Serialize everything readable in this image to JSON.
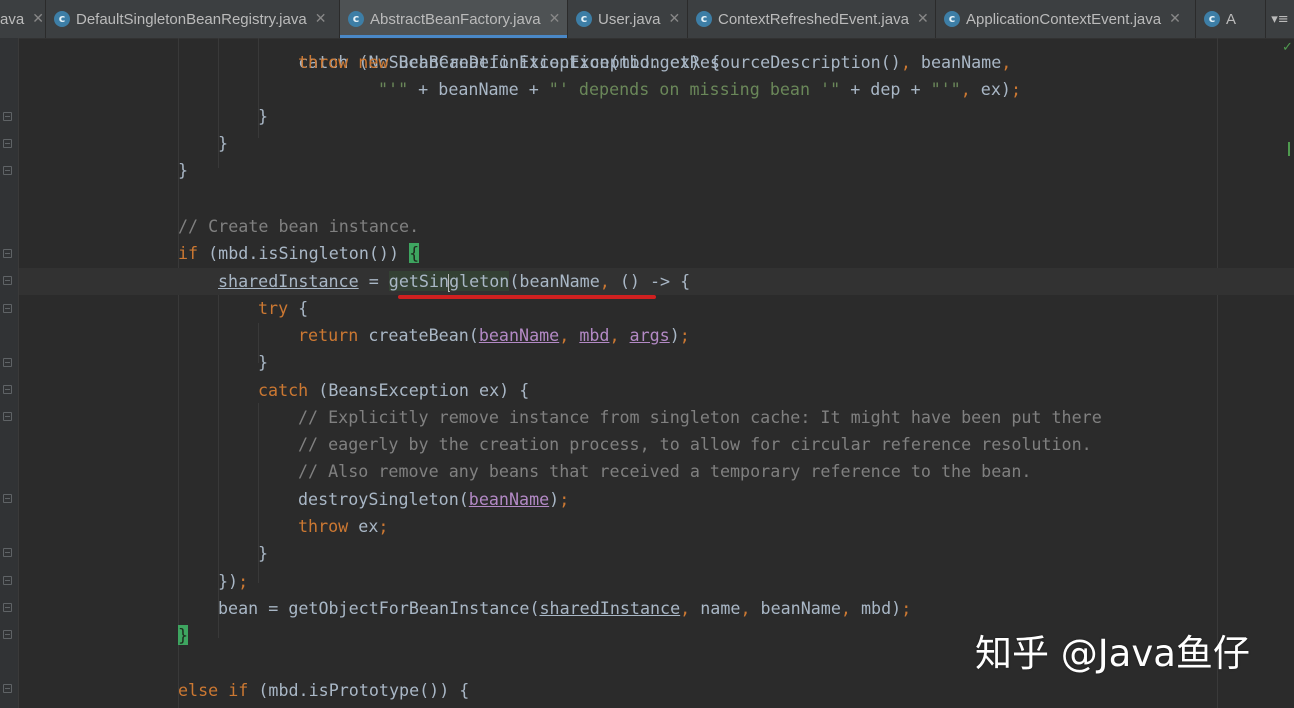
{
  "tabs": [
    {
      "label": "ava",
      "icon": "none",
      "active": false
    },
    {
      "label": "DefaultSingletonBeanRegistry.java",
      "icon": "java-class-icon",
      "active": false
    },
    {
      "label": "AbstractBeanFactory.java",
      "icon": "java-class-icon",
      "active": true
    },
    {
      "label": "User.java",
      "icon": "java-class-icon",
      "active": false
    },
    {
      "label": "ContextRefreshedEvent.java",
      "icon": "java-class-icon",
      "active": false
    },
    {
      "label": "ApplicationContextEvent.java",
      "icon": "java-class-icon",
      "active": false
    },
    {
      "label": "A",
      "icon": "java-class-icon",
      "active": false
    }
  ],
  "tab_menu_label": "▾≡",
  "code": {
    "l0": {
      "p1": "catch (NoSuchBeanDefinitionException ex) {"
    },
    "l1": {
      "p1": "throw",
      "p2": " ",
      "p3": "new",
      "p4": " BeanCreationException(mbd.getResourceDescription()",
      "p5": ",",
      "p6": " beanName",
      "p7": ","
    },
    "l2": {
      "p1": "\"'\"",
      "p2": " + beanName + ",
      "p3": "\"' depends on missing bean '\"",
      "p4": " + dep + ",
      "p5": "\"'\"",
      "p6": ",",
      "p7": " ex)",
      "p8": ";"
    },
    "l3": {
      "p1": "}"
    },
    "l4": {
      "p1": "}"
    },
    "l5": {
      "p1": "}"
    },
    "l7": {
      "p1": "// Create bean instance."
    },
    "l8": {
      "p1": "if",
      "p2": " (mbd.isSingleton()) ",
      "p3": "{"
    },
    "l9": {
      "p1": "sharedInstance",
      "p2": " = ",
      "p3": "getSin",
      "p4": "gleton",
      "p5": "(beanName",
      "p6": ",",
      "p7": " () -> {"
    },
    "l10": {
      "p1": "try",
      "p2": " {"
    },
    "l11": {
      "p1": "return",
      "p2": " createBean(",
      "p3": "beanName",
      "p4": ",",
      "p5": " ",
      "p6": "mbd",
      "p7": ",",
      "p8": " ",
      "p9": "args",
      "p10": ")",
      "p11": ";"
    },
    "l12": {
      "p1": "}"
    },
    "l13": {
      "p1": "catch",
      "p2": " (BeansException ex) {"
    },
    "l14": {
      "p1": "// Explicitly remove instance from singleton cache: It might have been put there"
    },
    "l15": {
      "p1": "// eagerly by the creation process, to allow for circular reference resolution."
    },
    "l16": {
      "p1": "// Also remove any beans that received a temporary reference to the bean."
    },
    "l17": {
      "p1": "destroySingleton(",
      "p2": "beanName",
      "p3": ")",
      "p4": ";"
    },
    "l18": {
      "p1": "throw",
      "p2": " ex",
      "p3": ";"
    },
    "l19": {
      "p1": "}"
    },
    "l20": {
      "p1": "})",
      "p2": ";"
    },
    "l21": {
      "p1": "bean = getObjectForBeanInstance(",
      "p2": "sharedInstance",
      "p3": ",",
      "p4": " name",
      "p5": ",",
      "p6": " beanName",
      "p7": ",",
      "p8": " mbd)",
      "p9": ";"
    },
    "l22": {
      "p1": "}"
    },
    "l24": {
      "p1": "else if",
      "p2": " (mbd.isPrototype()) {"
    }
  },
  "watermark": "知乎 @Java鱼仔",
  "colors": {
    "background": "#2b2b2b",
    "keyword": "#cc7832",
    "string": "#6a8759",
    "comment": "#808080",
    "parameter": "#b389c5",
    "annotation_underline": "#d02020"
  }
}
